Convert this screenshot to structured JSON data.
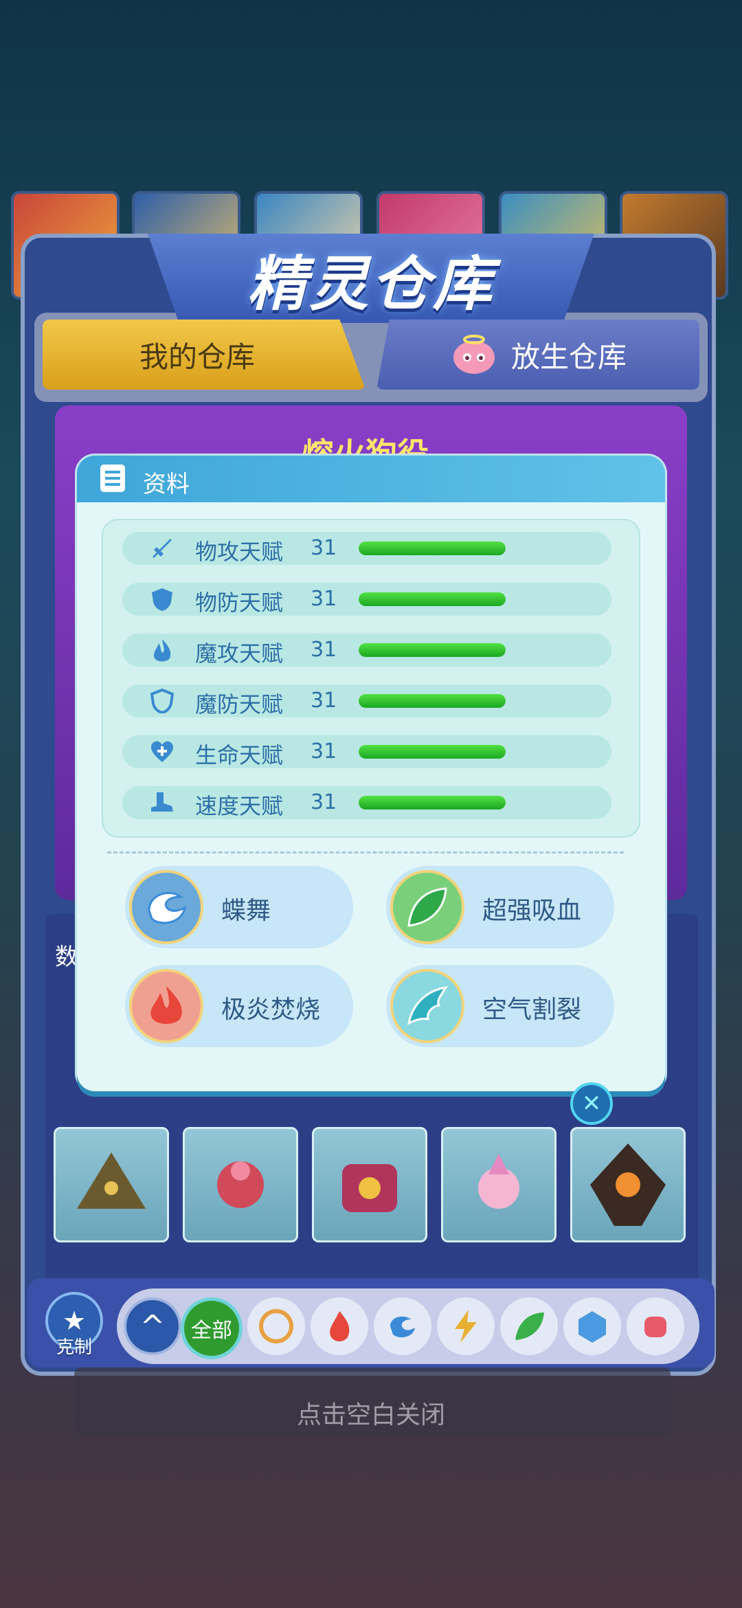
{
  "header": {
    "title": "精灵仓库"
  },
  "tabs": [
    {
      "label": "我的仓库",
      "active": true
    },
    {
      "label": "放生仓库",
      "active": false
    }
  ],
  "pet": {
    "name": "熔火狗役"
  },
  "dialog": {
    "title": "资料",
    "stats": [
      {
        "icon": "sword-icon",
        "label": "物攻天赋",
        "value": "31",
        "level": 1.0
      },
      {
        "icon": "shield-icon",
        "label": "物防天赋",
        "value": "31",
        "level": 1.0
      },
      {
        "icon": "flame-icon",
        "label": "魔攻天赋",
        "value": "31",
        "level": 1.0
      },
      {
        "icon": "magic-shield-icon",
        "label": "魔防天赋",
        "value": "31",
        "level": 1.0
      },
      {
        "icon": "heart-plus-icon",
        "label": "生命天赋",
        "value": "31",
        "level": 1.0
      },
      {
        "icon": "boot-icon",
        "label": "速度天赋",
        "value": "31",
        "level": 1.0
      }
    ],
    "skills": [
      {
        "icon": "butterfly-icon",
        "label": "蝶舞"
      },
      {
        "icon": "leaf-icon",
        "label": "超强吸血"
      },
      {
        "icon": "fire-icon",
        "label": "极炎焚烧"
      },
      {
        "icon": "wind-icon",
        "label": "空气割裂"
      }
    ]
  },
  "list": {
    "header_fragment": "数"
  },
  "filter": {
    "restrain_label": "克制",
    "all_label": "全部",
    "up_symbol": "^"
  },
  "footer": {
    "close_hint": "点击空白关闭"
  },
  "colors": {
    "accent": "#3fa6d9",
    "bar": "#1aa823",
    "tab_active": "#f2c84a"
  }
}
